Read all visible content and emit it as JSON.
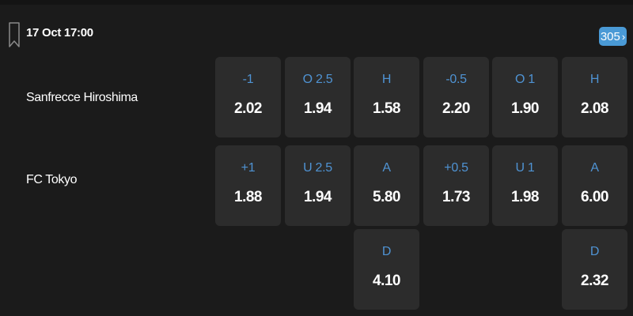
{
  "event": {
    "datetime": "17 Oct 17:00",
    "more_markets": "305"
  },
  "teams": {
    "home": "Sanfrecce Hiroshima",
    "away": "FC Tokyo"
  },
  "markets": {
    "handicap": {
      "home": {
        "label": "-1",
        "odds": "2.02"
      },
      "away": {
        "label": "+1",
        "odds": "1.88"
      }
    },
    "total": {
      "over": {
        "label": "O 2.5",
        "odds": "1.94"
      },
      "under": {
        "label": "U 2.5",
        "odds": "1.94"
      }
    },
    "result": {
      "home": {
        "label": "H",
        "odds": "1.58"
      },
      "away": {
        "label": "A",
        "odds": "5.80"
      },
      "draw": {
        "label": "D",
        "odds": "4.10"
      }
    },
    "first_half_handicap": {
      "home": {
        "label": "-0.5",
        "odds": "2.20"
      },
      "away": {
        "label": "+0.5",
        "odds": "1.73"
      }
    },
    "first_half_total": {
      "over": {
        "label": "O 1",
        "odds": "1.90"
      },
      "under": {
        "label": "U 1",
        "odds": "1.98"
      }
    },
    "first_half_result": {
      "home": {
        "label": "H",
        "odds": "2.08"
      },
      "away": {
        "label": "A",
        "odds": "6.00"
      },
      "draw": {
        "label": "D",
        "odds": "2.32"
      }
    }
  },
  "colors": {
    "background": "#1b1b1b",
    "cell": "#2c2c2c",
    "label": "#4f93d3",
    "accent_button": "#4a9ad6"
  },
  "icons": {
    "bookmark": "bookmark-icon",
    "more": "chevron-right-icon"
  }
}
